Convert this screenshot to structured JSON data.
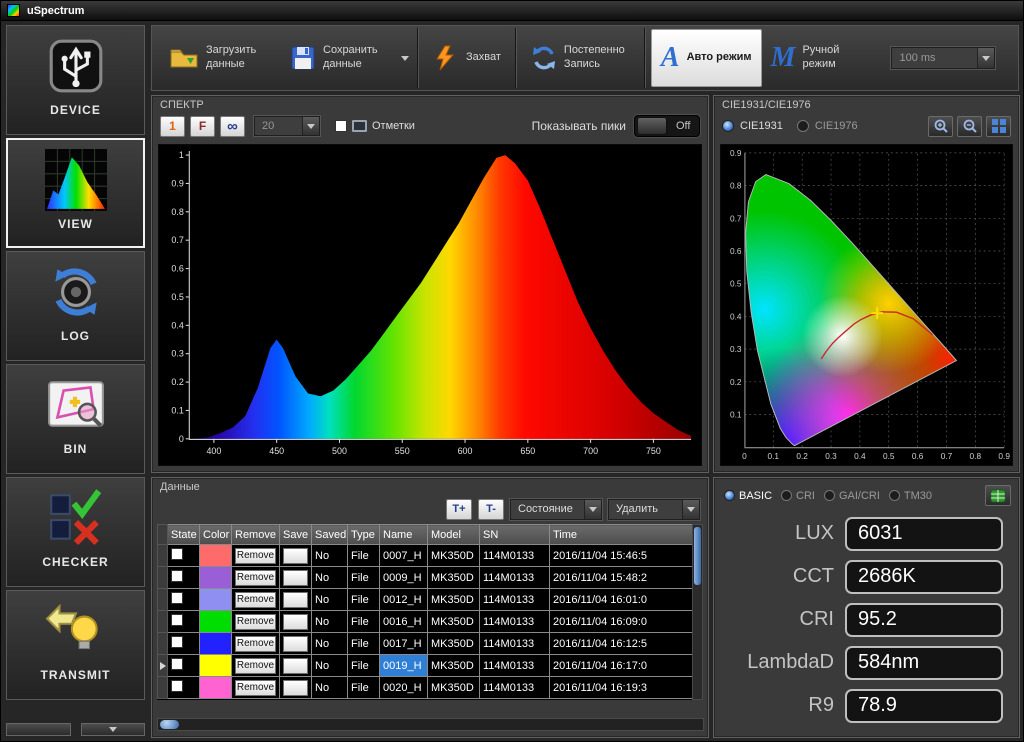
{
  "titlebar": {
    "title": "uSpectrum"
  },
  "sidebar": {
    "items": [
      {
        "id": "device",
        "label": "DEVICE"
      },
      {
        "id": "view",
        "label": "VIEW",
        "active": true
      },
      {
        "id": "log",
        "label": "LOG"
      },
      {
        "id": "bin",
        "label": "BIN"
      },
      {
        "id": "checker",
        "label": "CHECKER"
      },
      {
        "id": "transmit",
        "label": "TRANSMIT"
      }
    ]
  },
  "toolbar": {
    "load_label": "Загрузить данные",
    "save_label": "Сохранить данные",
    "capture_label": "Захват",
    "step_label": "Постепенно Запись",
    "auto_icon": "A",
    "auto_label": "Авто режим",
    "manual_icon": "M",
    "manual_label": "Ручной режим",
    "interval_value": "100 ms"
  },
  "spectrum": {
    "title": "СПЕКТР",
    "button_1": "1",
    "button_f": "F",
    "button_inf": "∞",
    "dropdown_value": "20",
    "marks_label": "Отметки",
    "peaks_label": "Показывать пики",
    "peaks_toggle": "Off",
    "chart_data": {
      "type": "area",
      "title": "СПЕКТР",
      "x_range": [
        380,
        780
      ],
      "y_range": [
        0,
        1
      ],
      "x_ticks": [
        400,
        450,
        500,
        550,
        600,
        650,
        700,
        750
      ],
      "y_ticks": [
        "0",
        "0.1",
        "0.2",
        "0.3",
        "0.4",
        "0.5",
        "0.6",
        "0.7",
        "0.8",
        "0.9",
        "1"
      ],
      "points": [
        [
          380,
          0
        ],
        [
          395,
          0.005
        ],
        [
          405,
          0.02
        ],
        [
          415,
          0.04
        ],
        [
          425,
          0.08
        ],
        [
          435,
          0.18
        ],
        [
          445,
          0.32
        ],
        [
          450,
          0.35
        ],
        [
          455,
          0.32
        ],
        [
          465,
          0.22
        ],
        [
          475,
          0.16
        ],
        [
          485,
          0.15
        ],
        [
          495,
          0.17
        ],
        [
          505,
          0.21
        ],
        [
          515,
          0.26
        ],
        [
          525,
          0.31
        ],
        [
          535,
          0.37
        ],
        [
          545,
          0.43
        ],
        [
          555,
          0.49
        ],
        [
          565,
          0.55
        ],
        [
          575,
          0.62
        ],
        [
          585,
          0.69
        ],
        [
          595,
          0.76
        ],
        [
          605,
          0.84
        ],
        [
          615,
          0.92
        ],
        [
          625,
          0.99
        ],
        [
          632,
          1.0
        ],
        [
          640,
          0.97
        ],
        [
          650,
          0.91
        ],
        [
          660,
          0.81
        ],
        [
          670,
          0.7
        ],
        [
          680,
          0.59
        ],
        [
          690,
          0.48
        ],
        [
          700,
          0.39
        ],
        [
          710,
          0.31
        ],
        [
          720,
          0.24
        ],
        [
          730,
          0.18
        ],
        [
          740,
          0.13
        ],
        [
          750,
          0.09
        ],
        [
          760,
          0.06
        ],
        [
          770,
          0.03
        ],
        [
          780,
          0.01
        ]
      ],
      "gradient": [
        [
          0,
          "#10002a"
        ],
        [
          0.05,
          "#2800a0"
        ],
        [
          0.13,
          "#2430f0"
        ],
        [
          0.18,
          "#0055ff"
        ],
        [
          0.24,
          "#00aaff"
        ],
        [
          0.28,
          "#00e0c0"
        ],
        [
          0.33,
          "#00d830"
        ],
        [
          0.41,
          "#66e400"
        ],
        [
          0.47,
          "#c8e400"
        ],
        [
          0.52,
          "#ffd800"
        ],
        [
          0.57,
          "#ff9000"
        ],
        [
          0.62,
          "#ff3800"
        ],
        [
          0.67,
          "#ff0800"
        ],
        [
          0.86,
          "#d00000"
        ],
        [
          1,
          "#980000"
        ]
      ]
    }
  },
  "cie": {
    "title": "CIE1931/CIE1976",
    "radio_1931": "CIE1931",
    "radio_1976": "CIE1976",
    "chart_data": {
      "type": "scatter",
      "diagram": "CIE1931 chromaticity",
      "axis_max": 0.9,
      "grid_values": [
        0.1,
        0.2,
        0.3,
        0.4,
        0.5,
        0.6,
        0.7,
        0.8,
        0.9
      ],
      "x_tick_labels": [
        "0",
        "0.1",
        "0.2",
        "0.3",
        "0.4",
        "0.5",
        "0.6",
        "0.7",
        "0.8",
        "0.9"
      ],
      "y_tick_labels": [
        "0.1",
        "0.2",
        "0.3",
        "0.4",
        "0.5",
        "0.6",
        "0.7",
        "0.8",
        "0.9"
      ],
      "locus": [
        [
          0.1741,
          0.005
        ],
        [
          0.1726,
          0.0048
        ],
        [
          0.1644,
          0.0109
        ],
        [
          0.144,
          0.0297
        ],
        [
          0.1241,
          0.0578
        ],
        [
          0.0913,
          0.1327
        ],
        [
          0.0454,
          0.295
        ],
        [
          0.0235,
          0.4127
        ],
        [
          0.0082,
          0.5384
        ],
        [
          0.0039,
          0.6548
        ],
        [
          0.0139,
          0.7502
        ],
        [
          0.0389,
          0.812
        ],
        [
          0.0743,
          0.8338
        ],
        [
          0.1547,
          0.8059
        ],
        [
          0.2296,
          0.7543
        ],
        [
          0.3016,
          0.6923
        ],
        [
          0.3731,
          0.6245
        ],
        [
          0.4441,
          0.5547
        ],
        [
          0.5125,
          0.4866
        ],
        [
          0.5752,
          0.4242
        ],
        [
          0.627,
          0.3725
        ],
        [
          0.6658,
          0.334
        ],
        [
          0.6915,
          0.3083
        ],
        [
          0.719,
          0.2809
        ],
        [
          0.7347,
          0.2653
        ]
      ],
      "planckian": [
        [
          0.652,
          0.344
        ],
        [
          0.585,
          0.393
        ],
        [
          0.527,
          0.413
        ],
        [
          0.477,
          0.414
        ],
        [
          0.437,
          0.404
        ],
        [
          0.405,
          0.391
        ],
        [
          0.38,
          0.377
        ],
        [
          0.347,
          0.352
        ],
        [
          0.323,
          0.333
        ],
        [
          0.306,
          0.318
        ],
        [
          0.285,
          0.295
        ],
        [
          0.266,
          0.27
        ]
      ],
      "marker": [
        0.46,
        0.41
      ],
      "marker_color": "#ffe000",
      "locus_fill_colors": {
        "base": "#00c400",
        "cyan": "#00e4ff",
        "blue": "#1418ff",
        "magenta": "#ff30ff",
        "red": "#ff1e00",
        "yellow": "#ffd000",
        "white": "#ffffff"
      }
    }
  },
  "data_table": {
    "title": "Данные",
    "text_plus": "T+",
    "text_minus": "T-",
    "state_dropdown": "Состояние",
    "delete_dropdown": "Удалить",
    "remove_label": "Remove",
    "headers": [
      "State",
      "Color",
      "Remove",
      "Save",
      "Saved",
      "Type",
      "Name",
      "Model",
      "SN",
      "Time"
    ],
    "rows": [
      {
        "color": "#ff6a6a",
        "saved": "No",
        "type": "File",
        "name": "0007_H",
        "model": "MK350D",
        "sn": "114M0133",
        "time": "2016/11/04 15:46:5"
      },
      {
        "color": "#9a5fd6",
        "saved": "No",
        "type": "File",
        "name": "0009_H",
        "model": "MK350D",
        "sn": "114M0133",
        "time": "2016/11/04 15:48:2"
      },
      {
        "color": "#8f8ff2",
        "saved": "No",
        "type": "File",
        "name": "0012_H",
        "model": "MK350D",
        "sn": "114M0133",
        "time": "2016/11/04 16:01:0"
      },
      {
        "color": "#00dd00",
        "saved": "No",
        "type": "File",
        "name": "0016_H",
        "model": "MK350D",
        "sn": "114M0133",
        "time": "2016/11/04 16:09:0"
      },
      {
        "color": "#2222ff",
        "saved": "No",
        "type": "File",
        "name": "0017_H",
        "model": "MK350D",
        "sn": "114M0133",
        "time": "2016/11/04 16:12:5"
      },
      {
        "color": "#ffff00",
        "saved": "No",
        "type": "File",
        "name": "0019_H",
        "model": "MK350D",
        "sn": "114M0133",
        "time": "2016/11/04 16:17:0",
        "selected": true
      },
      {
        "color": "#ff63d1",
        "saved": "No",
        "type": "File",
        "name": "0020_H",
        "model": "MK350D",
        "sn": "114M0133",
        "time": "2016/11/04 16:19:3"
      }
    ]
  },
  "measurements": {
    "tabs": [
      {
        "label": "BASIC",
        "active": true
      },
      {
        "label": "CRI"
      },
      {
        "label": "GAI/CRI"
      },
      {
        "label": "TM30"
      }
    ],
    "rows": [
      {
        "label": "LUX",
        "value": "6031"
      },
      {
        "label": "CCT",
        "value": "2686K"
      },
      {
        "label": "CRI",
        "value": "95.2"
      },
      {
        "label": "LambdaD",
        "value": "584nm"
      },
      {
        "label": "R9",
        "value": "78.9"
      }
    ]
  }
}
